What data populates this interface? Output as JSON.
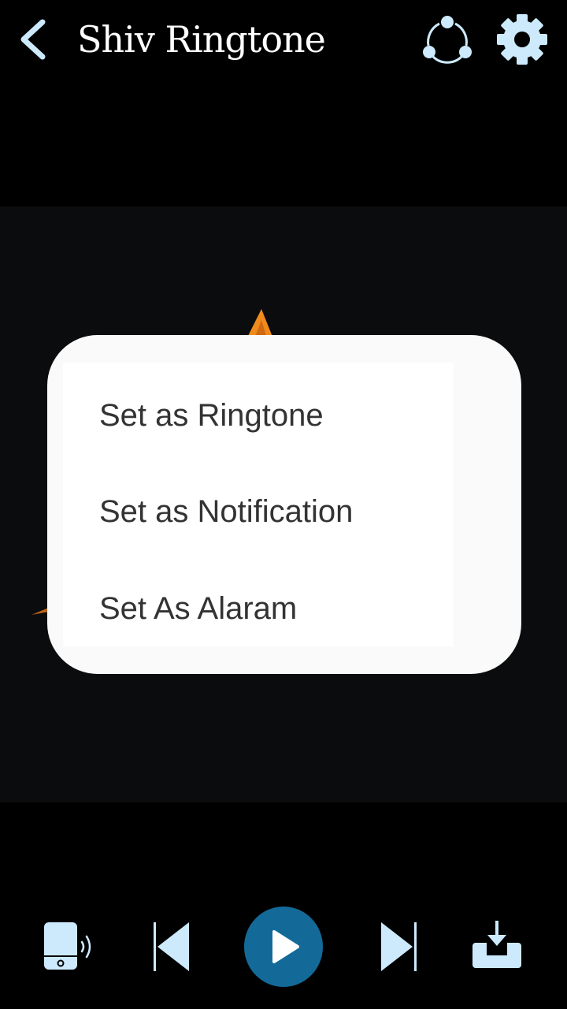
{
  "header": {
    "title": "Shiv Ringtone",
    "back_icon": "chevron-left-icon",
    "share_icon": "share-icon",
    "settings_icon": "gear-icon"
  },
  "menu": {
    "items": [
      {
        "label": "Set as Ringtone"
      },
      {
        "label": "Set as Notification"
      },
      {
        "label": "Set As Alaram"
      }
    ]
  },
  "controls": {
    "ringtone_icon": "phone-ringing-icon",
    "previous_icon": "skip-previous-icon",
    "play_icon": "play-icon",
    "next_icon": "skip-next-icon",
    "download_icon": "download-icon"
  },
  "colors": {
    "icon": "#cdeafd",
    "play_button": "#136a99",
    "background": "#000000",
    "artwork_bg": "#0a0c0e",
    "accent_flame": "#f08a1c"
  }
}
